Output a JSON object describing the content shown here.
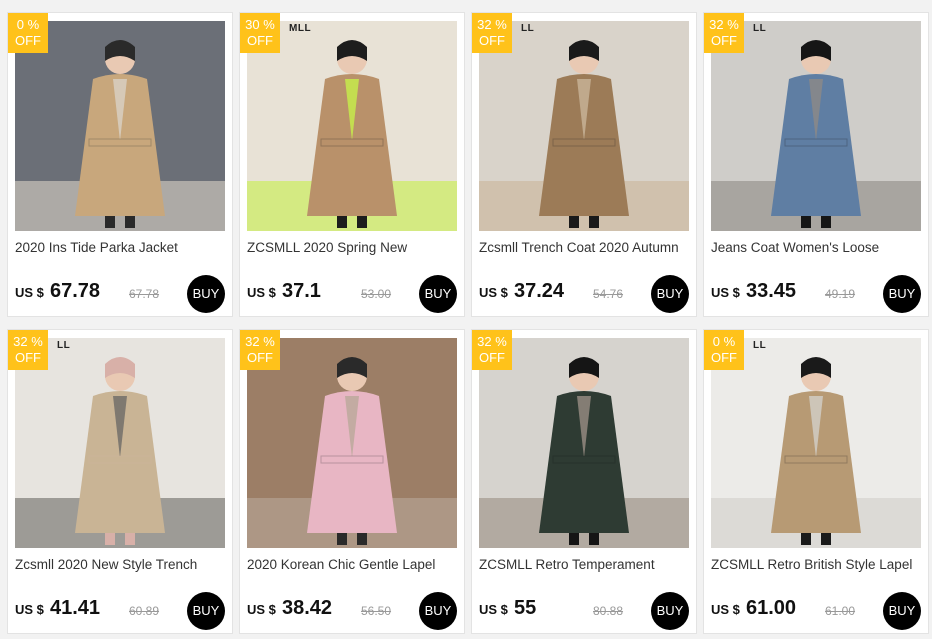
{
  "products": [
    {
      "badge_pct": "0 %",
      "badge_off": "OFF",
      "brand_mark": "",
      "title": "2020 Ins Tide Parka Jacket",
      "currency": "US $",
      "price": "67.78",
      "old_price": "67.78",
      "buy": "BUY",
      "palette": [
        "#6b6f77",
        "#c8a77c",
        "#d9d2c6",
        "#2a2a2a"
      ]
    },
    {
      "badge_pct": "30 %",
      "badge_off": "OFF",
      "brand_mark": "MLL",
      "title": "ZCSMLL 2020 Spring New",
      "currency": "US $",
      "price": "37.1",
      "old_price": "53.00",
      "buy": "BUY",
      "palette": [
        "#e8e2d6",
        "#b9916a",
        "#c7f04a",
        "#1d1d1d"
      ]
    },
    {
      "badge_pct": "32 %",
      "badge_off": "OFF",
      "brand_mark": "LL",
      "title": "Zcsmll Trench Coat 2020 Autumn",
      "currency": "US $",
      "price": "37.24",
      "old_price": "54.76",
      "buy": "BUY",
      "palette": [
        "#d9d3ca",
        "#9c7b57",
        "#c9b59a",
        "#1a1a1a"
      ]
    },
    {
      "badge_pct": "32 %",
      "badge_off": "OFF",
      "brand_mark": "LL",
      "title": "Jeans Coat Women's Loose",
      "currency": "US $",
      "price": "33.45",
      "old_price": "49.19",
      "buy": "BUY",
      "palette": [
        "#cfcdc9",
        "#5f7ea3",
        "#8d8a86",
        "#161616"
      ]
    },
    {
      "badge_pct": "32 %",
      "badge_off": "OFF",
      "brand_mark": "LL",
      "title": "Zcsmll 2020 New Style Trench",
      "currency": "US $",
      "price": "41.41",
      "old_price": "60.89",
      "buy": "BUY",
      "palette": [
        "#e7e4df",
        "#c9b495",
        "#6d6a66",
        "#d8b0a8"
      ]
    },
    {
      "badge_pct": "32 %",
      "badge_off": "OFF",
      "brand_mark": "",
      "title": "2020 Korean Chic Gentle Lapel",
      "currency": "US $",
      "price": "38.42",
      "old_price": "56.50",
      "buy": "BUY",
      "palette": [
        "#9c7e66",
        "#e8b6c4",
        "#b9a99a",
        "#2a2a2a"
      ]
    },
    {
      "badge_pct": "32 %",
      "badge_off": "OFF",
      "brand_mark": "",
      "title": "ZCSMLL Retro Temperament",
      "currency": "US $",
      "price": "55",
      "old_price": "80.88",
      "buy": "BUY",
      "palette": [
        "#d6d3ce",
        "#2e3b33",
        "#9a8f84",
        "#151515"
      ]
    },
    {
      "badge_pct": "0 %",
      "badge_off": "OFF",
      "brand_mark": "LL",
      "title": "ZCSMLL Retro British Style Lapel",
      "currency": "US $",
      "price": "61.00",
      "old_price": "61.00",
      "buy": "BUY",
      "palette": [
        "#ecebe8",
        "#b79a74",
        "#d2cfc9",
        "#1a1a1a"
      ]
    }
  ]
}
